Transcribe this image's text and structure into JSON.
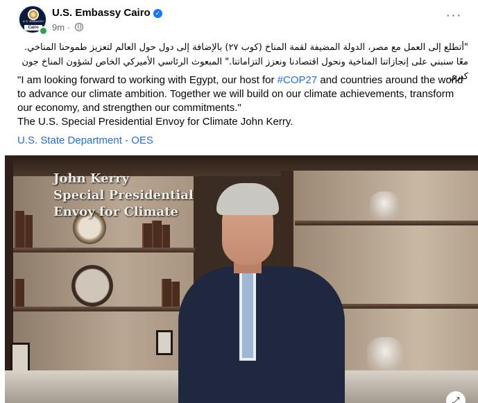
{
  "post": {
    "page_name": "U.S. Embassy Cairo",
    "avatar": {
      "mini_text": "U.S. EMBASSY",
      "city": "Cairo"
    },
    "time": "9m",
    "separator": "·",
    "more_icon": "more-horizontal-icon",
    "privacy_icon": "globe-icon",
    "verified_icon": "verified-badge-icon",
    "arabic_text": "\"أتطلع إلى العمل مع مصر، الدولة المضيفة لقمة المناخ (كوب ٢٧) بالإضافة إلى دول حول العالم لتعزيز طموحنا المناخي. معًا سنبني على إنجازاتنا المناخية ونحول اقتصادنا ونعزز التزاماتنا.\" المبعوث الرئاسي الأميركي الخاص لشؤون المناخ جون كيري.",
    "english_before": "\"I am looking forward to working with Egypt, our host for ",
    "hashtag": "#COP27",
    "english_after": " and countries around the world to advance our climate ambition. Together we will build on our climate achievements, transform our economy, and strengthen our commitments.\"",
    "english_signoff": "The U.S. Special Presidential Envoy for Climate John Kerry.",
    "link_text": "U.S. State Department - OES"
  },
  "video": {
    "caption_line1": "John Kerry",
    "caption_line2": "Special Presidential",
    "caption_line3": "Envoy for Climate",
    "fullscreen_icon": "expand-icon"
  },
  "colors": {
    "link": "#216fdb",
    "verified": "#1877f2",
    "online": "#31a24c",
    "muted": "#65676b"
  }
}
